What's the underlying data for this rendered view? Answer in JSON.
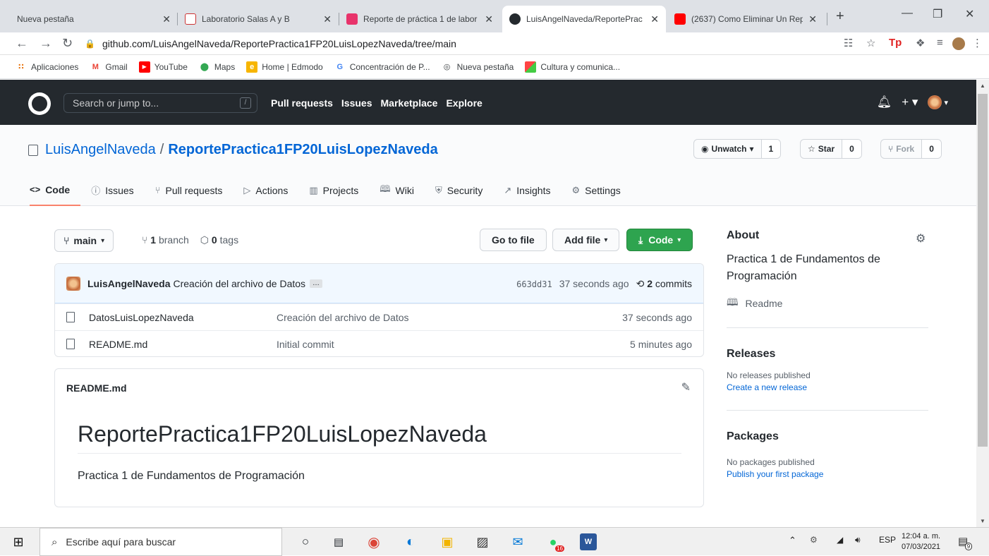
{
  "browser": {
    "tabs": [
      {
        "label": "Nueva pestaña",
        "active": false
      },
      {
        "label": "Laboratorio Salas A y B",
        "active": false
      },
      {
        "label": "Reporte de práctica 1 de labor",
        "active": false
      },
      {
        "label": "LuisAngelNaveda/ReportePrac",
        "active": true
      },
      {
        "label": "(2637) Como Eliminar Un Repo",
        "active": false
      }
    ],
    "close_glyph": "✕",
    "new_tab": "+",
    "url": "github.com/LuisAngelNaveda/ReportePractica1FP20LuisLopezNaveda/tree/main",
    "bookmarks": [
      {
        "label": "Aplicaciones",
        "icon": "apps-grid-icon",
        "color": "#e8710a"
      },
      {
        "label": "Gmail",
        "icon": "gmail-icon",
        "color": "#ea4335"
      },
      {
        "label": "YouTube",
        "icon": "youtube-icon",
        "color": "#ff0000"
      },
      {
        "label": "Maps",
        "icon": "maps-pin-icon",
        "color": "#34a853"
      },
      {
        "label": "Home | Edmodo",
        "icon": "edmodo-icon",
        "color": "#f7b500"
      },
      {
        "label": "Concentración de P...",
        "icon": "google-g-icon",
        "color": "#4285f4"
      },
      {
        "label": "Nueva pestaña",
        "icon": "globe-icon",
        "color": "#3c4043"
      },
      {
        "label": "Cultura y comunica...",
        "icon": "colorful-square-icon",
        "color": "#9c27b0"
      }
    ]
  },
  "github": {
    "search_placeholder": "Search or jump to...",
    "search_key": "/",
    "nav": [
      "Pull requests",
      "Issues",
      "Marketplace",
      "Explore"
    ],
    "accent": "#0366d6"
  },
  "repo": {
    "owner": "LuisAngelNaveda",
    "separator": "/",
    "name": "ReportePractica1FP20LuisLopezNaveda",
    "unwatch_label": "Unwatch",
    "unwatch_count": "1",
    "star_label": "Star",
    "star_count": "0",
    "fork_label": "Fork",
    "fork_count": "0",
    "tabs": [
      {
        "label": "Code",
        "icon": "code-icon",
        "selected": true
      },
      {
        "label": "Issues",
        "icon": "issue-icon"
      },
      {
        "label": "Pull requests",
        "icon": "pull-request-icon"
      },
      {
        "label": "Actions",
        "icon": "play-icon"
      },
      {
        "label": "Projects",
        "icon": "project-icon"
      },
      {
        "label": "Wiki",
        "icon": "book-icon"
      },
      {
        "label": "Security",
        "icon": "shield-icon"
      },
      {
        "label": "Insights",
        "icon": "graph-icon"
      },
      {
        "label": "Settings",
        "icon": "gear-icon"
      }
    ]
  },
  "main": {
    "branch": "main",
    "branch_count": "1",
    "branch_word": "branch",
    "tag_count": "0",
    "tag_word": "tags",
    "go_to_file": "Go to file",
    "add_file": "Add file",
    "code_button": "Code",
    "latest_commit": {
      "author": "LuisAngelNaveda",
      "message": "Creación del archivo de Datos",
      "sha": "663dd31",
      "age": "37 seconds ago",
      "commits_count": "2",
      "commits_word": "commits"
    },
    "files": [
      {
        "name": "DatosLuisLopezNaveda",
        "message": "Creación del archivo de Datos",
        "age": "37 seconds ago"
      },
      {
        "name": "README.md",
        "message": "Initial commit",
        "age": "5 minutes ago"
      }
    ],
    "readme": {
      "file": "README.md",
      "heading": "ReportePractica1FP20LuisLopezNaveda",
      "body": "Practica 1 de Fundamentos de Programación"
    }
  },
  "sidebar": {
    "about_title": "About",
    "description": "Practica 1 de Fundamentos de Programación",
    "readme_label": "Readme",
    "releases_title": "Releases",
    "releases_empty": "No releases published",
    "releases_link": "Create a new release",
    "packages_title": "Packages",
    "packages_empty": "No packages published",
    "packages_link": "Publish your first package"
  },
  "taskbar": {
    "search_placeholder": "Escribe aquí para buscar",
    "lang": "ESP",
    "time": "12:04 a. m.",
    "date": "07/03/2021",
    "notif_count": "9",
    "whatsapp_badge": "16"
  }
}
